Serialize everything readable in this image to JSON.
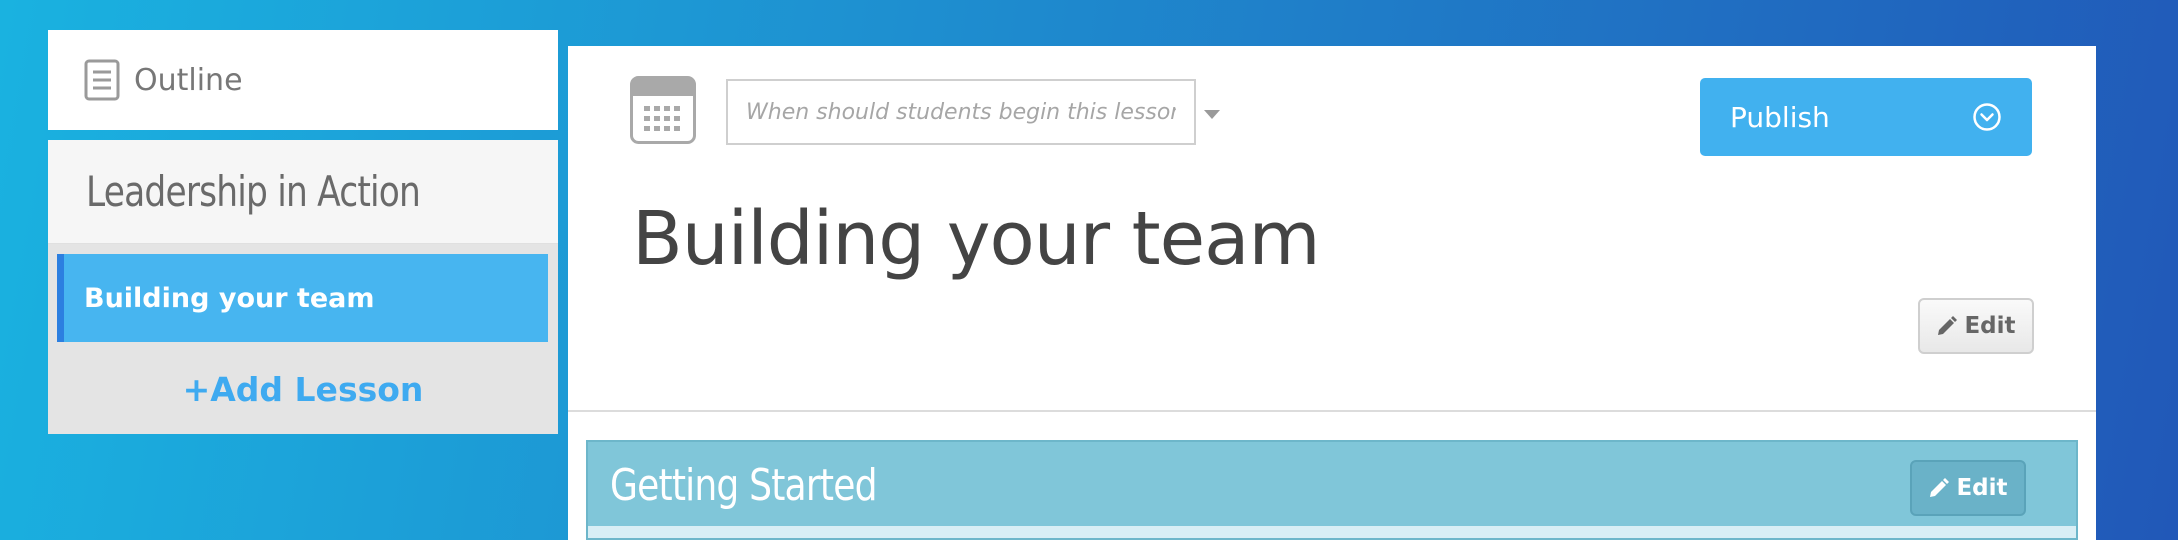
{
  "sidebar": {
    "outline_label": "Outline",
    "course_title": "Leadership in Action",
    "lessons": [
      {
        "label": "Building your team",
        "active": true
      }
    ],
    "add_lesson_label": "+Add Lesson"
  },
  "lesson": {
    "date_placeholder": "When should students begin this lesson?",
    "publish_label": "Publish",
    "title": "Building your team",
    "edit_label": "Edit"
  },
  "section": {
    "title": "Getting Started",
    "edit_label": "Edit"
  },
  "colors": {
    "accent": "#41b1ef",
    "active_lesson": "#47b5f0",
    "section_bar": "#80c6d9"
  },
  "icons": {
    "outline": "document-icon",
    "calendar": "calendar-icon",
    "publish_chevron": "chevron-down-circle-icon",
    "edit": "pencil-icon"
  }
}
